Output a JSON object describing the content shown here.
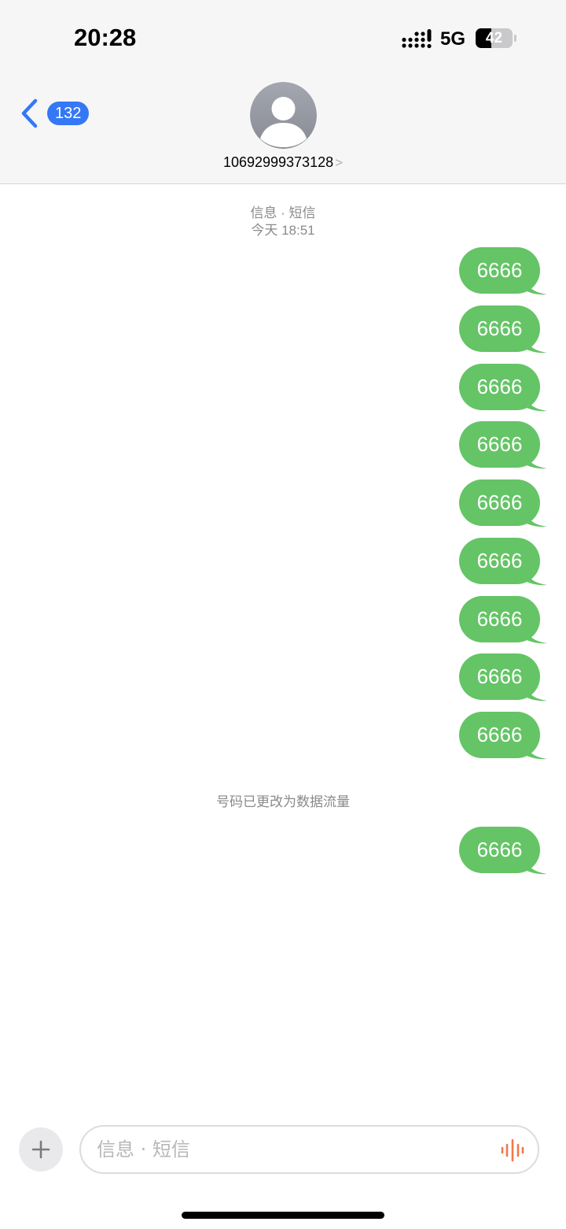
{
  "status_bar": {
    "time": "20:28",
    "network": "5G",
    "battery_level": "42",
    "battery_percent": 42,
    "signal_icon": "cellular-signal-icon"
  },
  "nav": {
    "back_badge": "132",
    "back_icon": "chevron-left-icon",
    "contact_name": "10692999373128",
    "contact_chevron": ">",
    "avatar_icon": "person-silhouette-icon"
  },
  "thread": {
    "service_label": "信息 · 短信",
    "timestamp": "今天 18:51",
    "messages_before": [
      "6666",
      "6666",
      "6666",
      "6666",
      "6666",
      "6666",
      "6666",
      "6666",
      "6666"
    ],
    "system_note": "号码已更改为数据流量",
    "messages_after": [
      "6666"
    ]
  },
  "compose": {
    "add_icon": "plus-icon",
    "placeholder": "信息 · 短信",
    "voice_icon": "voice-waveform-icon"
  },
  "colors": {
    "bubble": "#65c466",
    "accent": "#3478f6",
    "waveform": "#f2784b"
  }
}
